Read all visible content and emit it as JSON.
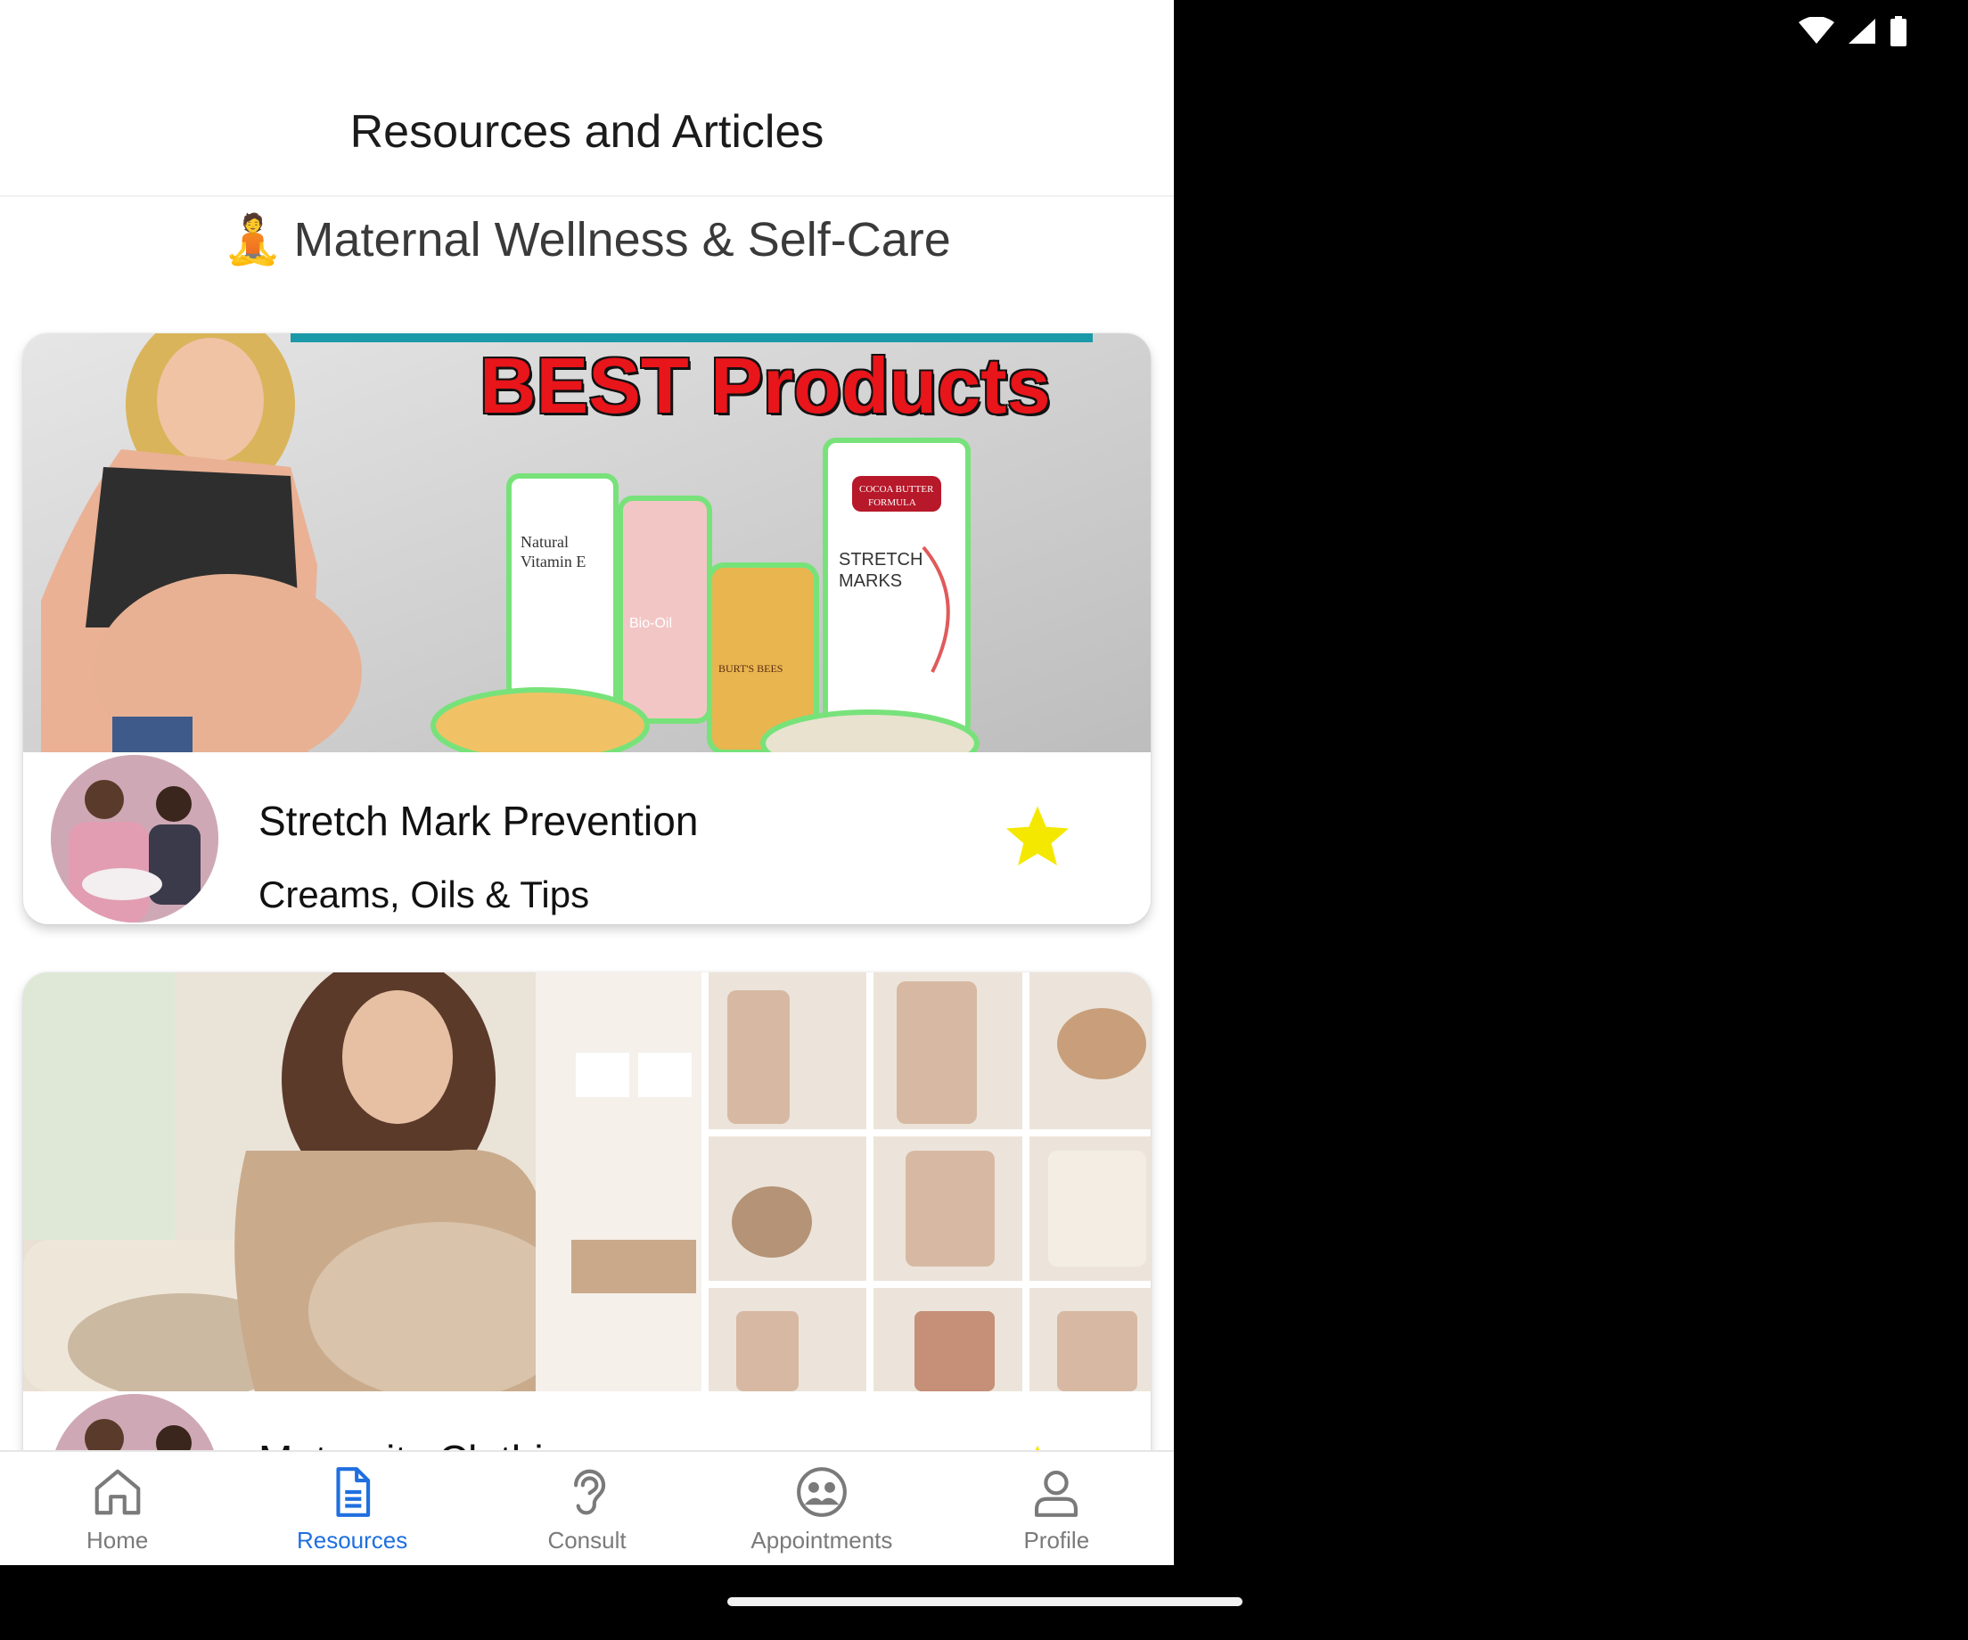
{
  "header": {
    "title": "Resources and Articles"
  },
  "section": {
    "emoji": "🧘",
    "title": "Maternal Wellness & Self-Care"
  },
  "cards": [
    {
      "banner_text": "BEST Products",
      "title": "Stretch Mark Prevention",
      "subtitle": "Creams, Oils & Tips",
      "favorite": true,
      "product_labels": [
        "Natural Vitamin E",
        "Bio-Oil",
        "BURT'S BEES",
        "COCOA BUTTER FORMULA",
        "STRETCH MARKS"
      ]
    },
    {
      "title": "Maternity Clothing",
      "favorite": true
    }
  ],
  "nav": {
    "items": [
      {
        "label": "Home",
        "icon": "home-icon",
        "active": false
      },
      {
        "label": "Resources",
        "icon": "document-icon",
        "active": true
      },
      {
        "label": "Consult",
        "icon": "ear-icon",
        "active": false
      },
      {
        "label": "Appointments",
        "icon": "appointments-icon",
        "active": false
      },
      {
        "label": "Profile",
        "icon": "profile-icon",
        "active": false
      }
    ]
  },
  "colors": {
    "accent": "#1f6fe0",
    "nav_inactive": "#7a7a7a",
    "star": "#f5e800",
    "banner_red": "#e8151b"
  }
}
